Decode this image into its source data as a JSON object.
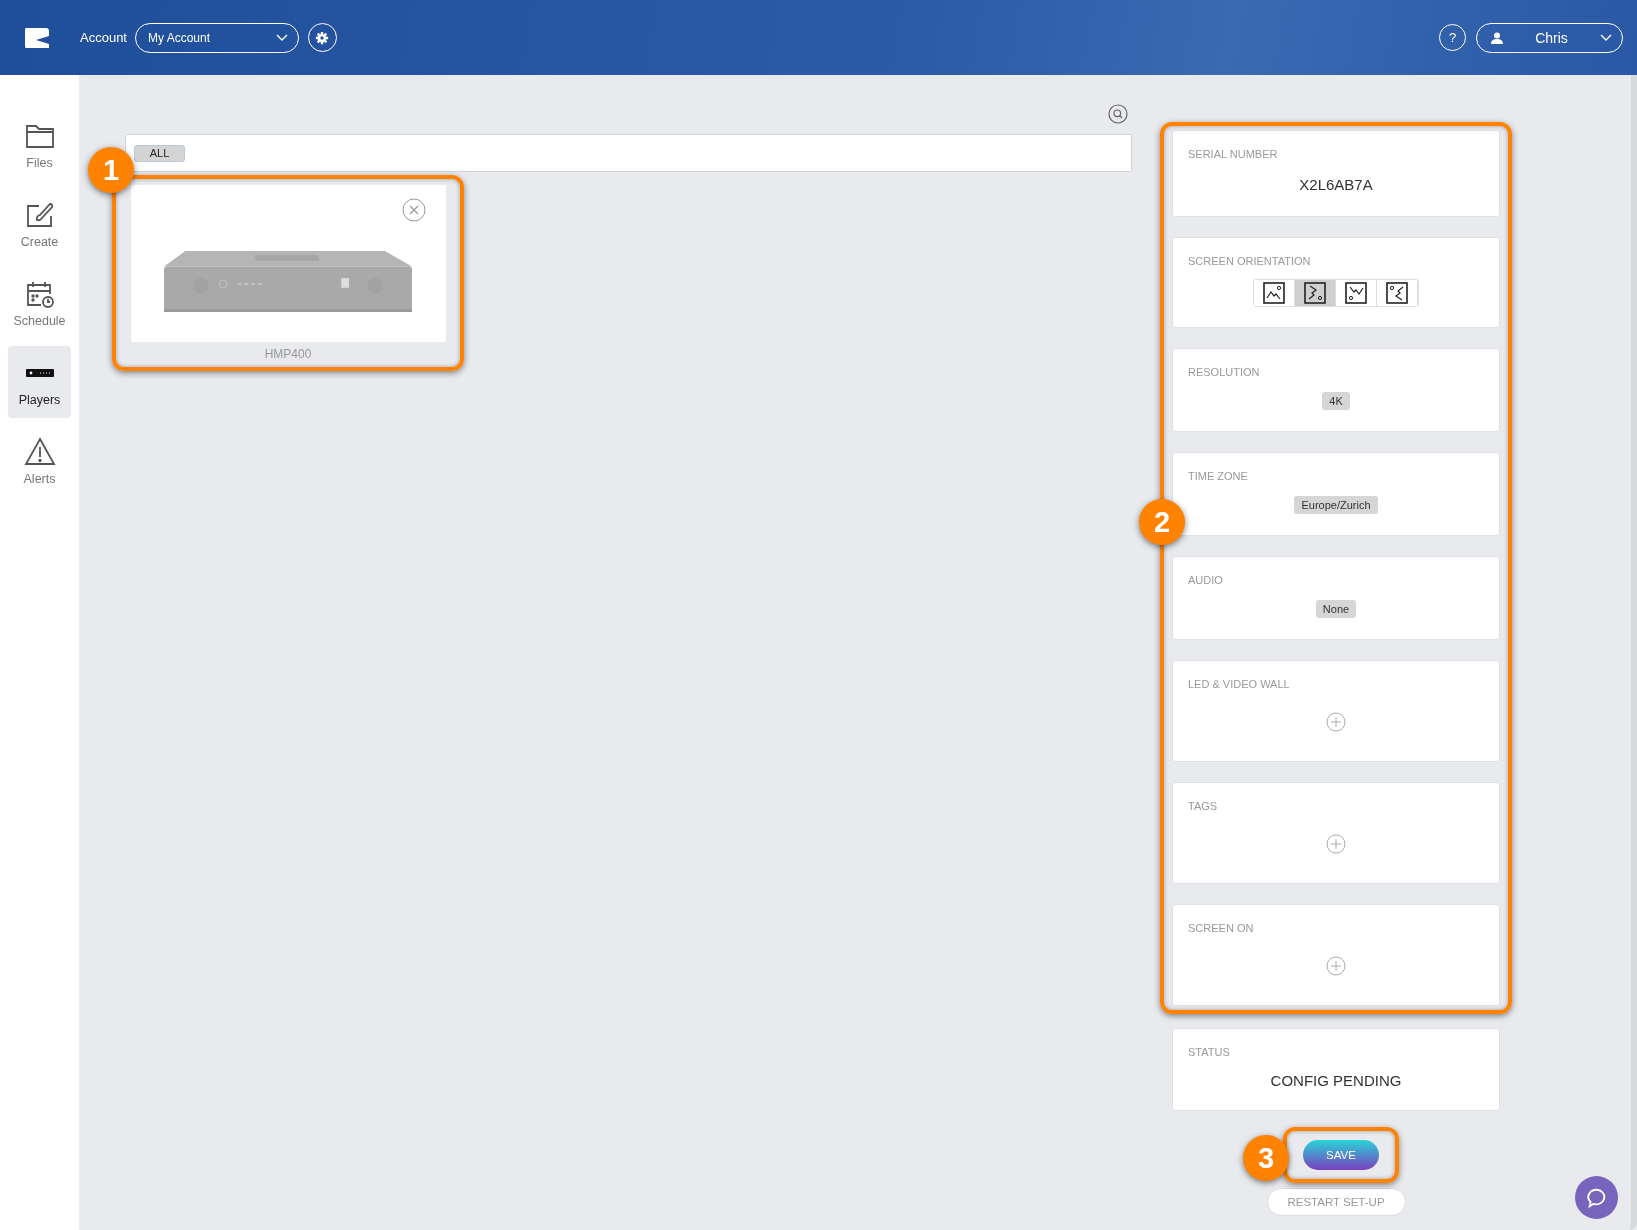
{
  "header": {
    "account_label": "Account",
    "account_select": "My Account",
    "help": "?",
    "user": "Chris"
  },
  "sidebar": {
    "items": [
      {
        "kind": "folder",
        "label": "Files",
        "selected": false
      },
      {
        "kind": "create",
        "label": "Create",
        "selected": false
      },
      {
        "kind": "schedule",
        "label": "Schedule",
        "selected": false
      },
      {
        "kind": "player",
        "label": "Players",
        "selected": true
      },
      {
        "kind": "alert",
        "label": "Alerts",
        "selected": false
      }
    ]
  },
  "filter": {
    "chips": [
      {
        "label": "ALL"
      }
    ]
  },
  "players": [
    {
      "name": "HMP400",
      "kind": "picture"
    }
  ],
  "settings": [
    {
      "kind": "text",
      "label": "SERIAL NUMBER",
      "value": "X2L6AB7A"
    },
    {
      "kind": "orientation",
      "label": "SCREEN ORIENTATION",
      "options": [
        {
          "selected": false
        },
        {
          "selected": true
        },
        {
          "selected": false
        },
        {
          "selected": false
        }
      ]
    },
    {
      "kind": "chip",
      "label": "RESOLUTION",
      "value": "4K"
    },
    {
      "kind": "chip",
      "label": "TIME ZONE",
      "value": "Europe/Zurich"
    },
    {
      "kind": "chip",
      "label": "AUDIO",
      "value": "None"
    },
    {
      "kind": "add",
      "label": "LED & VIDEO WALL"
    },
    {
      "kind": "add",
      "label": "TAGS"
    },
    {
      "kind": "add",
      "label": "SCREEN ON"
    }
  ],
  "status": {
    "label": "STATUS",
    "value": "CONFIG PENDING"
  },
  "buttons": {
    "save": "SAVE",
    "restart": "RESTART SET-UP"
  },
  "callouts": [
    "1",
    "2",
    "3"
  ]
}
